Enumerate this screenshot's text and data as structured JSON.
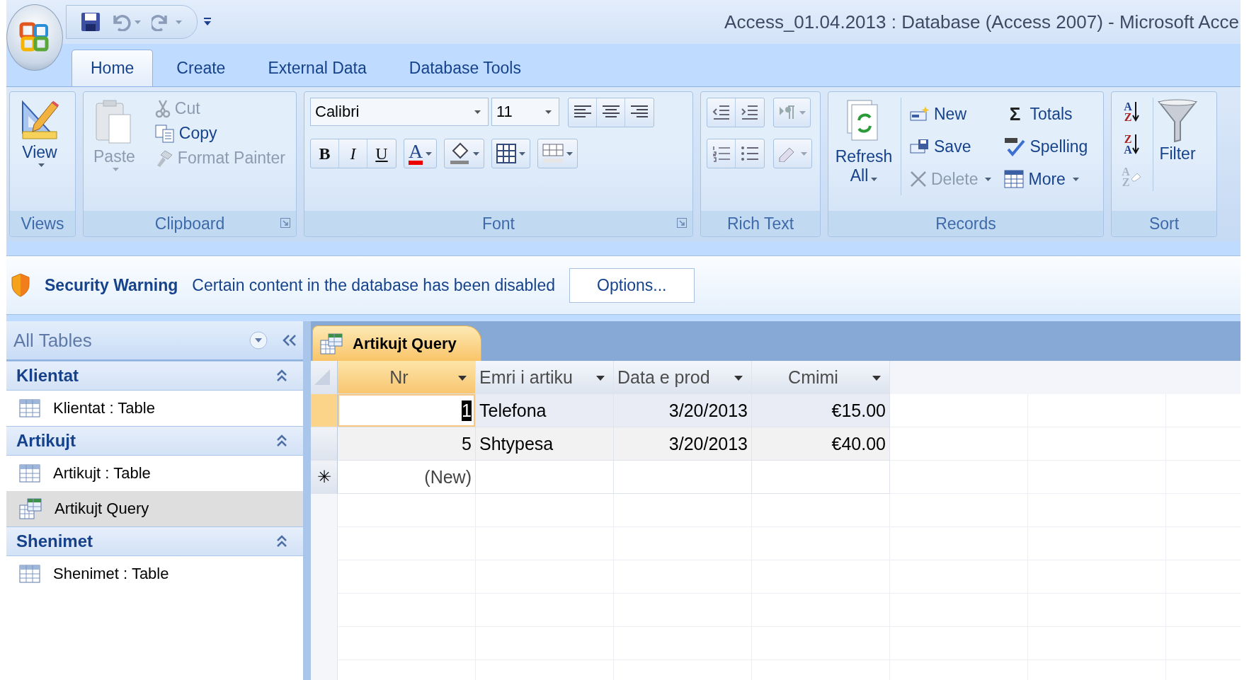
{
  "window": {
    "title": "Access_01.04.2013 : Database (Access 2007) - Microsoft Acce"
  },
  "tabs": [
    {
      "label": "Home",
      "selected": true
    },
    {
      "label": "Create",
      "selected": false
    },
    {
      "label": "External Data",
      "selected": false
    },
    {
      "label": "Database Tools",
      "selected": false
    }
  ],
  "ribbon": {
    "groups": [
      {
        "kind": "views",
        "label": "Views",
        "button": "View"
      },
      {
        "kind": "clipboard",
        "label": "Clipboard",
        "paste": {
          "label": "Paste",
          "disabled": true
        },
        "items": [
          {
            "kind": "cut",
            "label": "Cut",
            "disabled": true
          },
          {
            "kind": "copy",
            "label": "Copy",
            "disabled": false
          },
          {
            "kind": "painter",
            "label": "Format Painter",
            "disabled": true
          }
        ]
      },
      {
        "kind": "font",
        "label": "Font",
        "font": "Calibri",
        "size": "11",
        "styles": [
          "B",
          "I",
          "U"
        ],
        "color_letter": "A"
      },
      {
        "kind": "rich_text",
        "label": "Rich Text"
      },
      {
        "kind": "records",
        "label": "Records",
        "refresh": "Refresh All",
        "items": [
          {
            "kind": "new",
            "label": "New",
            "disabled": false,
            "dropdown": false
          },
          {
            "kind": "save",
            "label": "Save",
            "disabled": false,
            "dropdown": false
          },
          {
            "kind": "delete",
            "label": "Delete",
            "disabled": true,
            "dropdown": true
          },
          {
            "kind": "totals",
            "label": "Totals",
            "glyph": "Σ",
            "disabled": false,
            "dropdown": false
          },
          {
            "kind": "spelling",
            "label": "Spelling",
            "disabled": false,
            "dropdown": false
          },
          {
            "kind": "more",
            "label": "More",
            "disabled": false,
            "dropdown": true
          }
        ]
      },
      {
        "kind": "sort",
        "label": "Sort",
        "sorts": [
          {
            "top": "A",
            "bottom": "Z",
            "disabled": false
          },
          {
            "top": "Z",
            "bottom": "A",
            "disabled": false
          },
          {
            "top": "A",
            "bottom": "Z",
            "disabled": true
          }
        ],
        "filter": "Filter"
      }
    ]
  },
  "security_bar": {
    "title": "Security Warning",
    "message": "Certain content in the database has been disabled",
    "button": "Options..."
  },
  "navigation": {
    "title": "All Tables",
    "groups": [
      {
        "label": "Klientat",
        "expanded": true,
        "items": [
          {
            "kind": "table",
            "label": "Klientat : Table",
            "selected": false
          }
        ]
      },
      {
        "label": "Artikujt",
        "expanded": true,
        "items": [
          {
            "kind": "table",
            "label": "Artikujt : Table",
            "selected": false
          },
          {
            "kind": "query",
            "label": "Artikujt Query",
            "selected": true
          }
        ]
      },
      {
        "label": "Shenimet",
        "expanded": true,
        "items": [
          {
            "kind": "table",
            "label": "Shenimet : Table",
            "selected": false
          }
        ]
      }
    ]
  },
  "datasheet": {
    "tab": "Artikujt Query",
    "columns": [
      {
        "label": "Nr",
        "selected": true
      },
      {
        "label": "Emri i artiku",
        "selected": false
      },
      {
        "label": "Data e prod",
        "selected": false
      },
      {
        "label": "Cmimi",
        "selected": false
      }
    ],
    "rows": [
      {
        "selected": true,
        "cells": [
          "1",
          "Telefona",
          "3/20/2013",
          "€15.00"
        ]
      },
      {
        "selected": false,
        "cells": [
          "5",
          "Shtypesa",
          "3/20/2013",
          "€40.00"
        ]
      }
    ],
    "new_row": {
      "marker": "✳",
      "label": "(New)"
    }
  }
}
